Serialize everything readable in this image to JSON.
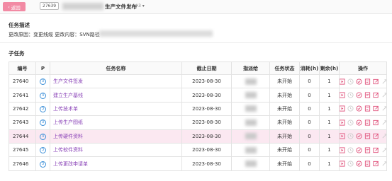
{
  "header": {
    "back_label": "返回",
    "task_id": "27639",
    "title_suffix": "生产文件发布",
    "version": "#3 ▾"
  },
  "task_desc": {
    "heading": "任务描述",
    "text": "更改原因：变更线缆 更改内容：SVN路径"
  },
  "subtasks": {
    "heading": "子任务",
    "columns": [
      "编号",
      "P",
      "任务名称",
      "截止日期",
      "指派给",
      "任务状态",
      "消耗(h)",
      "剩余(h)",
      "操作"
    ],
    "rows": [
      {
        "id": "27640",
        "p": "3",
        "name": "生产文件签发",
        "due": "2023-08-30",
        "status": "未开始",
        "consumed": "0",
        "remaining": "1"
      },
      {
        "id": "27641",
        "p": "3",
        "name": "建立生产基线",
        "due": "2023-08-30",
        "status": "未开始",
        "consumed": "0",
        "remaining": "1"
      },
      {
        "id": "27642",
        "p": "3",
        "name": "上传技术单",
        "due": "2023-08-30",
        "status": "未开始",
        "consumed": "0",
        "remaining": "1"
      },
      {
        "id": "27643",
        "p": "3",
        "name": "上传生产图纸",
        "due": "2023-08-30",
        "status": "未开始",
        "consumed": "0",
        "remaining": "1"
      },
      {
        "id": "27644",
        "p": "3",
        "name": "上传硬件资料",
        "due": "2023-08-30",
        "status": "未开始",
        "consumed": "0",
        "remaining": "1"
      },
      {
        "id": "27645",
        "p": "3",
        "name": "上传软件资料",
        "due": "2023-08-30",
        "status": "未开始",
        "consumed": "0",
        "remaining": "1"
      },
      {
        "id": "27646",
        "p": "3",
        "name": "上传更改申请单",
        "due": "2023-08-30",
        "status": "未开始",
        "consumed": "0",
        "remaining": "1"
      }
    ],
    "highlight_row": "27644",
    "op_icons": [
      "start-icon",
      "assign-icon",
      "finish-icon",
      "record-icon",
      "edit-icon",
      "split-icon"
    ]
  },
  "colors": {
    "back_button": "#f28aa4",
    "task_name": "#8b44b8",
    "op_icon": "#e0507a",
    "priority_badge": "#3b8fd8",
    "highlight_row": "#fbe8f1"
  }
}
